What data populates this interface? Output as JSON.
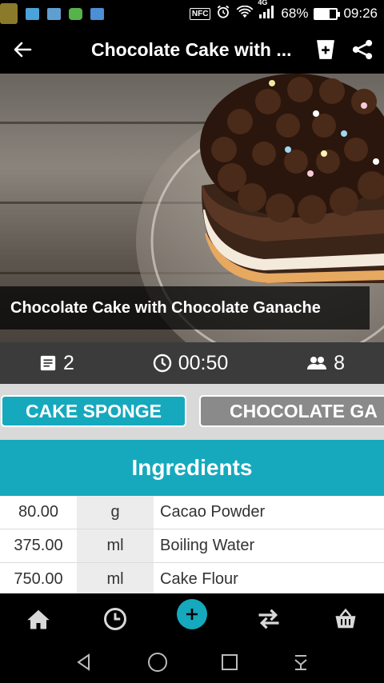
{
  "status_bar": {
    "nfc_label": "NFC",
    "network_label": "4G",
    "battery_percent": "68%",
    "battery_level": 0.68,
    "time": "09:26"
  },
  "app_bar": {
    "title": "Chocolate Cake with ..."
  },
  "recipe": {
    "title": "Chocolate Cake with Chocolate Ganache",
    "steps_count": "2",
    "duration": "00:50",
    "servings": "8"
  },
  "tabs": [
    {
      "label": "CAKE SPONGE",
      "active": true
    },
    {
      "label": "CHOCOLATE GA",
      "active": false
    }
  ],
  "ingredients": {
    "header": "Ingredients",
    "rows": [
      {
        "quantity": "80.00",
        "unit": "g",
        "name": "Cacao Powder"
      },
      {
        "quantity": "375.00",
        "unit": "ml",
        "name": "Boiling Water"
      },
      {
        "quantity": "750.00",
        "unit": "ml",
        "name": "Cake Flour"
      }
    ]
  },
  "colors": {
    "accent": "#16a9bd",
    "meta_bar": "#3b3b3b",
    "tab_inactive": "#8a8a8a"
  },
  "icons": {
    "back": "arrow-left-icon",
    "add_to_list": "add-to-list-icon",
    "share": "share-icon",
    "steps": "list-icon",
    "time": "clock-icon",
    "servings": "people-icon",
    "home": "home-icon",
    "history": "history-icon",
    "add": "plus-icon",
    "swap": "swap-icon",
    "basket": "basket-icon"
  }
}
